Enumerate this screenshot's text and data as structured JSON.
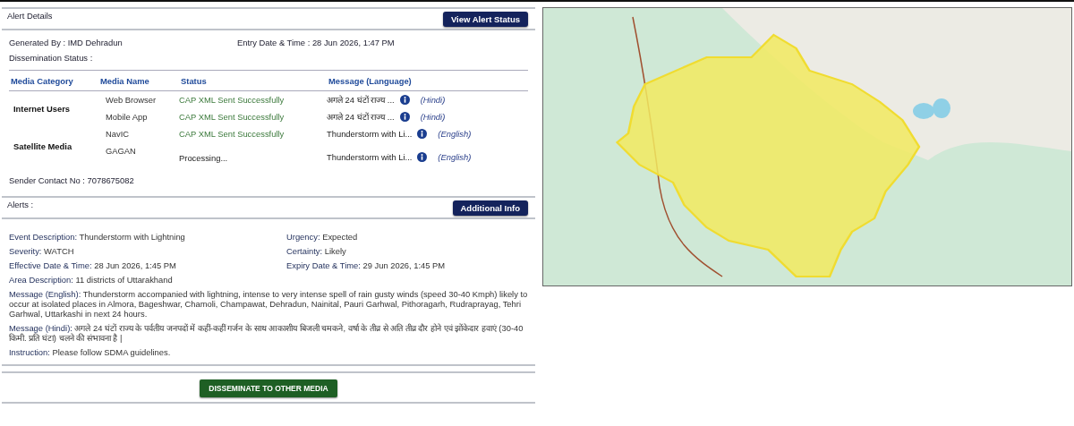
{
  "alert_details": {
    "title": "Alert Details",
    "button": "View Alert Status",
    "generated_by": "Generated By : IMD Dehradun",
    "entry_time": "Entry Date & Time : 28 Jun 2026, 1:47 PM",
    "dissemination_status": "Dissemination Status :",
    "table": {
      "columns": [
        "Media Category",
        "Media Name",
        "Status",
        "Message (Language)"
      ],
      "groups": [
        {
          "category": "Internet Users",
          "rows": [
            {
              "media": "Web Browser",
              "status": "CAP XML Sent Successfully",
              "kind": "sent",
              "message": "अगले 24 घंटों राज्य ...",
              "language": "(Hindi)"
            },
            {
              "media": "Mobile App",
              "status": "CAP XML Sent Successfully",
              "kind": "sent",
              "message": "अगले 24 घंटों राज्य ...",
              "language": "(Hindi)"
            }
          ]
        },
        {
          "category": "Satellite Media",
          "rows": [
            {
              "media": "NavIC",
              "status": "CAP XML Sent Successfully",
              "kind": "sent",
              "message": "Thunderstorm with Li...",
              "language": "(English)"
            },
            {
              "media": "GAGAN",
              "status": "Processing...",
              "kind": "processing",
              "message": "Thunderstorm with Li...",
              "language": "(English)"
            }
          ]
        }
      ]
    },
    "sender_contact": "Sender Contact No : 7078675082"
  },
  "alerts": {
    "title": "Alerts :",
    "button": "Additional Info",
    "grid_fields": [
      {
        "label": "Event Description:",
        "value": "Thunderstorm with Lightning"
      },
      {
        "label": "Urgency:",
        "value": "Expected"
      },
      {
        "label": "Severity:",
        "value": "WATCH"
      },
      {
        "label": "Certainty:",
        "value": "Likely"
      },
      {
        "label": "Effective Date & Time:",
        "value": "28 Jun 2026, 1:45 PM"
      },
      {
        "label": "Expiry Date & Time:",
        "value": "29 Jun 2026, 1:45 PM"
      }
    ],
    "fields": [
      {
        "label": "Area Description:",
        "value": "11 districts of Uttarakhand"
      },
      {
        "label": "Message (English):",
        "value": "Thunderstorm accompanied with lightning, intense to very intense spell of rain gusty winds (speed 30-40 Kmph) likely to occur at isolated places in Almora, Bageshwar, Chamoli, Champawat, Dehradun, Nainital, Pauri Garhwal, Pithoragarh, Rudraprayag, Tehri Garhwal, Uttarkashi in next 24 hours."
      },
      {
        "label": "Message (Hindi):",
        "value": "अगले 24 घंटों राज्य के पर्वतीय जनपदों में कहीं-कहीं गर्जन के साथ आकाशीय बिजली चमकने, वर्षा के तीव्र से अति तीव्र दौर होने एवं झोंकेदार हवाएं (30-40 किमी. प्रति घंटा) चलने की संभावना है |"
      },
      {
        "label": "Instruction:",
        "value": "Please follow SDMA guidelines."
      }
    ]
  },
  "footer_button": "DISSEMINATE TO OTHER MEDIA"
}
